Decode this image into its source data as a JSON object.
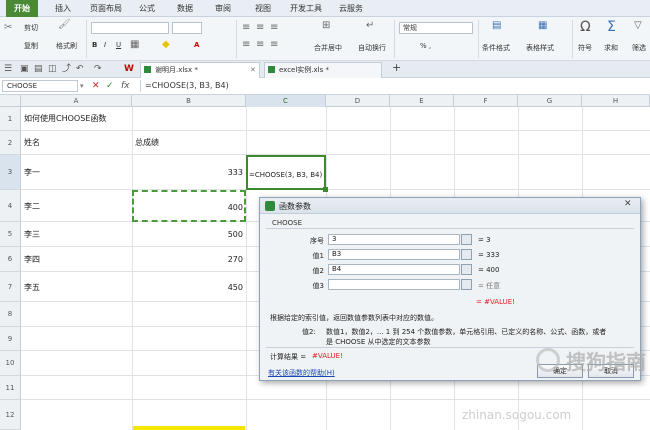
{
  "menubar": {
    "items": [
      "开始",
      "插入",
      "页面布局",
      "公式",
      "数据",
      "审阅",
      "视图",
      "开发工具",
      "云服务"
    ]
  },
  "ribbon": {
    "cut": "剪切",
    "copy": "复制",
    "format_painter": "格式刷",
    "merge_center": "合并居中",
    "wrap_text": "自动换行",
    "number_format": "常规",
    "cond_format": "条件格式",
    "table_style": "表格样式",
    "symbol": "符号",
    "sum": "求和",
    "filter": "筛选",
    "percent": "% ,",
    "omega": "Ω",
    "sigma": "Σ",
    "font_color_a": "A",
    "bold": "B",
    "italic": "I",
    "underline": "U"
  },
  "tabs": [
    {
      "label": "谢明月.xlsx *"
    },
    {
      "label": "excel实例.xls *"
    }
  ],
  "tabbar": {
    "add": "+"
  },
  "formula_bar": {
    "name_box": "CHOOSE",
    "cancel": "✕",
    "confirm": "✓",
    "fx": "fx",
    "formula": "=CHOOSE(3, B3, B4)"
  },
  "columns": [
    "A",
    "B",
    "C",
    "D",
    "E",
    "F",
    "G",
    "H"
  ],
  "rows": [
    "1",
    "2",
    "3",
    "4",
    "5",
    "6",
    "7",
    "8",
    "9",
    "10",
    "11",
    "12"
  ],
  "cells": {
    "a1": "如何使用CHOOSE函数",
    "a2": "姓名",
    "b2": "总成绩",
    "a3": "李一",
    "b3": "333",
    "c3": "=CHOOSE(3, B3, B4)",
    "a4": "李二",
    "b4": "400",
    "a5": "李三",
    "b5": "500",
    "a6": "李四",
    "b6": "270",
    "a7": "李五",
    "b7": "450"
  },
  "dialog": {
    "title": "函数参数",
    "function_name": "CHOOSE",
    "args": [
      {
        "label": "序号",
        "value": "3",
        "result": "= 3"
      },
      {
        "label": "值1",
        "value": "B3",
        "result": "= 333"
      },
      {
        "label": "值2",
        "value": "B4",
        "result": "= 400"
      },
      {
        "label": "值3",
        "value": "",
        "result": "= 任意"
      }
    ],
    "overall_result": "= #VALUE!",
    "description": "根据给定的索引值，返回数值参数列表中对应的数值。",
    "param_label": "值2:",
    "param_desc_1": "数值1，数值2，... 1 到 254 个数值参数，单元格引用、已定义的名称、公式、函数，或者",
    "param_desc_2": "是 CHOOSE 从中选定的文本参数",
    "calc_label": "计算结果 =",
    "calc_value": "#VALUE!",
    "help_link": "有关该函数的帮助(H)",
    "ok": "确定",
    "cancel": "取消"
  },
  "watermark": {
    "brand": "搜狗指南",
    "url": "zhinan.sogou.com"
  },
  "colors": {
    "accent_green": "#4a8a37",
    "error_red": "#e02020",
    "link_blue": "#1a47b8"
  }
}
